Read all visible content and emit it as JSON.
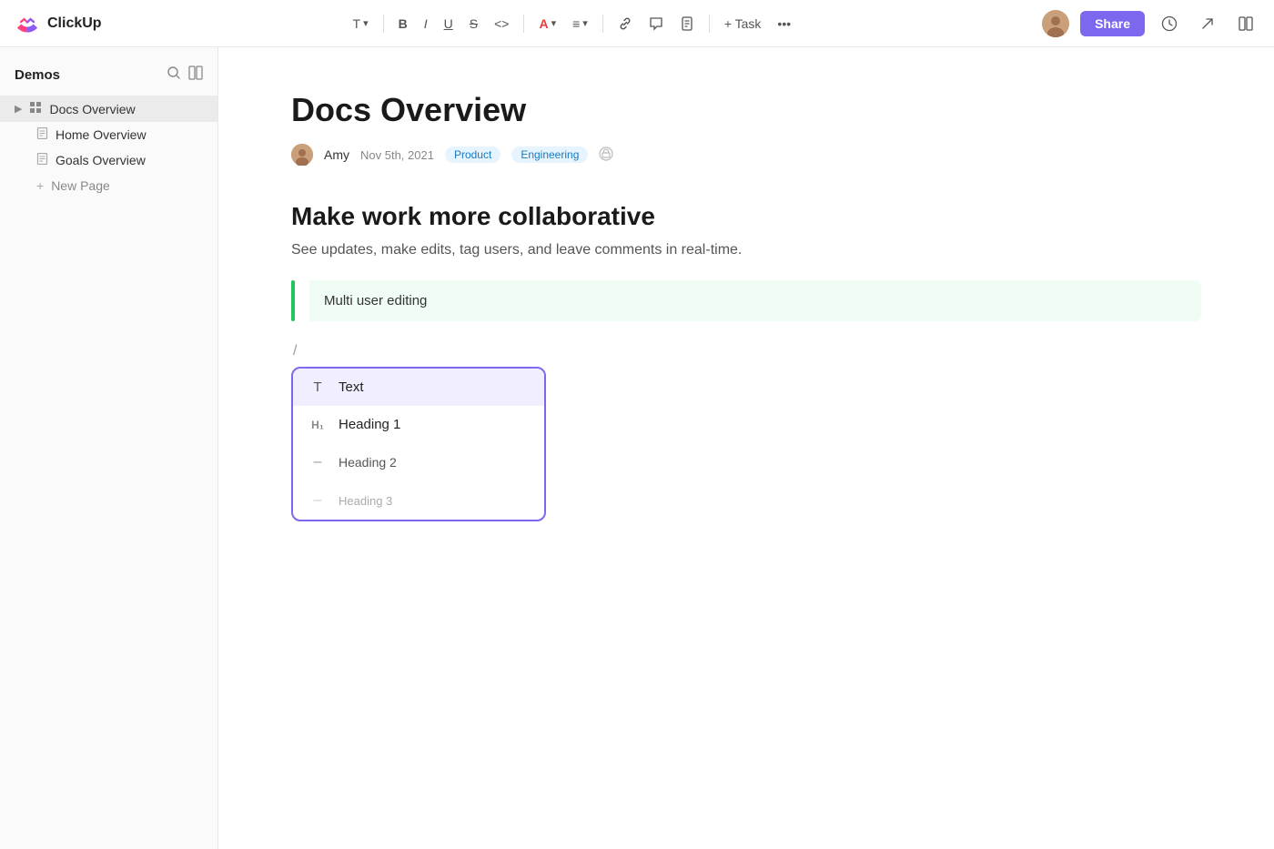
{
  "app": {
    "name": "ClickUp"
  },
  "toolbar": {
    "text_btn": "T",
    "bold_btn": "B",
    "italic_btn": "I",
    "underline_btn": "U",
    "strikethrough_btn": "S",
    "code_btn": "<>",
    "font_color_btn": "A",
    "align_btn": "≡",
    "link_btn": "🔗",
    "comment_btn": "💬",
    "doc_btn": "📄",
    "task_btn": "+ Task",
    "more_btn": "•••",
    "share_label": "Share"
  },
  "sidebar": {
    "title": "Demos",
    "search_icon": "🔍",
    "layout_icon": "⊞",
    "items": [
      {
        "label": "Docs Overview",
        "icon": "grid",
        "active": true,
        "has_arrow": true
      },
      {
        "label": "Home Overview",
        "icon": "doc",
        "active": false
      },
      {
        "label": "Goals Overview",
        "icon": "doc",
        "active": false
      }
    ],
    "new_page_label": "New Page"
  },
  "document": {
    "title": "Docs Overview",
    "author": "Amy",
    "date": "Nov 5th, 2021",
    "tags": [
      "Product",
      "Engineering"
    ],
    "heading": "Make work more collaborative",
    "subtitle": "See updates, make edits, tag users, and leave comments in real-time.",
    "blockquote": "Multi user editing",
    "slash": "/",
    "dropdown_items": [
      {
        "icon": "T",
        "label": "Text",
        "active": true
      },
      {
        "icon": "H₁",
        "label": "Heading 1",
        "active": false
      },
      {
        "icon": "–",
        "label": "Heading 2",
        "active": false
      },
      {
        "icon": "–",
        "label": "Heading 3",
        "active": false
      }
    ]
  }
}
